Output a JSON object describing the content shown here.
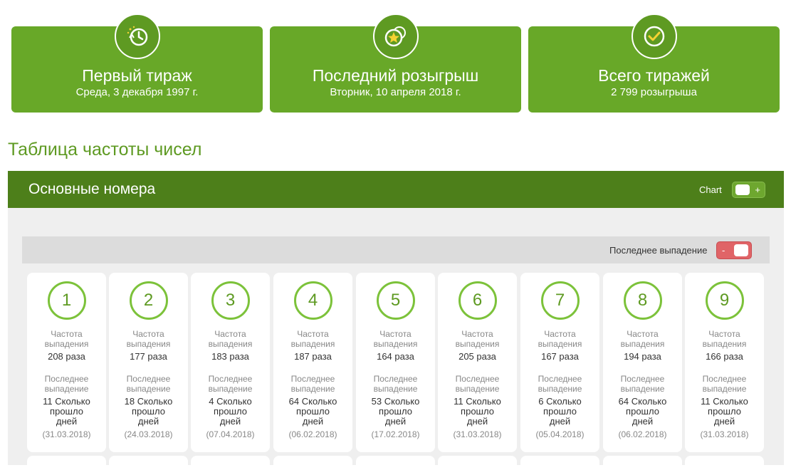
{
  "stats": [
    {
      "title": "Первый тираж",
      "subtitle": "Среда, 3 декабря 1997 г.",
      "icon": "history-clock-icon"
    },
    {
      "title": "Последний розыгрыш",
      "subtitle": "Вторник, 10 апреля 2018 г.",
      "icon": "star-coins-icon"
    },
    {
      "title": "Всего тиражей",
      "subtitle": "2 799 розыгрыша",
      "icon": "check-circle-icon"
    }
  ],
  "section_title": "Таблица частоты чисел",
  "panel": {
    "title": "Основные номера",
    "chart_label": "Chart",
    "chart_toggle_sign": "+",
    "last_label": "Последнее выпадение",
    "last_toggle_sign": "-"
  },
  "labels": {
    "freq": "Частота выпадения",
    "last": "Последнее выпадение"
  },
  "numbers": [
    {
      "n": "1",
      "freq": "208 раза",
      "last": "11 Сколько прошло дней",
      "date": "(31.03.2018)"
    },
    {
      "n": "2",
      "freq": "177 раза",
      "last": "18 Сколько прошло дней",
      "date": "(24.03.2018)"
    },
    {
      "n": "3",
      "freq": "183 раза",
      "last": "4 Сколько прошло дней",
      "date": "(07.04.2018)"
    },
    {
      "n": "4",
      "freq": "187 раза",
      "last": "64 Сколько прошло дней",
      "date": "(06.02.2018)"
    },
    {
      "n": "5",
      "freq": "164 раза",
      "last": "53 Сколько прошло дней",
      "date": "(17.02.2018)"
    },
    {
      "n": "6",
      "freq": "205 раза",
      "last": "11 Сколько прошло дней",
      "date": "(31.03.2018)"
    },
    {
      "n": "7",
      "freq": "167 раза",
      "last": "6 Сколько прошло дней",
      "date": "(05.04.2018)"
    },
    {
      "n": "8",
      "freq": "194 раза",
      "last": "64 Сколько прошло дней",
      "date": "(06.02.2018)"
    },
    {
      "n": "9",
      "freq": "166 раза",
      "last": "11 Сколько прошло дней",
      "date": "(31.03.2018)"
    }
  ],
  "colors": {
    "accent": "#68a828",
    "header": "#4d7f1a",
    "ball": "#7cc23a",
    "toggle_red": "#e06467"
  }
}
